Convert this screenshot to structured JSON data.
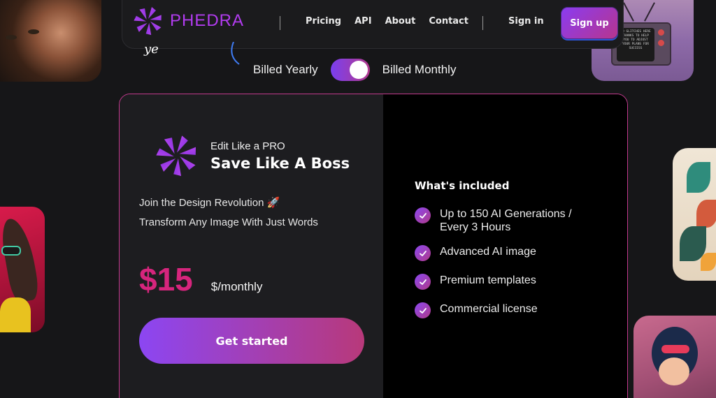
{
  "colors": {
    "accent_purple": "#8a3cf2",
    "accent_pink": "#d6257d",
    "card_border": "#c2398d",
    "brand_text": "#b23cf0"
  },
  "navbar": {
    "brand": "PHEDRA",
    "links": [
      "Pricing",
      "API",
      "About",
      "Contact"
    ],
    "signin": "Sign in",
    "signup": "Sign up"
  },
  "decor": {
    "script_fragment": "ye",
    "tv_screen_text": "NO GLITCHES HERE THANKS TO HELP YOU TO ADJUST YOUR PLANS FOR SUCCESS"
  },
  "billing": {
    "yearly_label": "Billed Yearly",
    "monthly_label": "Billed Monthly",
    "selected": "monthly"
  },
  "plan": {
    "kicker": "Edit Like a PRO",
    "title": "Save Like A Boss",
    "description_line1": "Join the Design Revolution 🚀",
    "description_line2": "Transform Any Image With Just Words",
    "price": "$15",
    "price_unit": "$/monthly",
    "cta": "Get started"
  },
  "included": {
    "title": "What's included",
    "items": [
      "Up to 150 AI Generations / Every 3 Hours",
      "Advanced AI image",
      "Premium templates",
      "Commercial license"
    ]
  },
  "icons": {
    "brand_logo": "pinwheel-logo-icon",
    "check": "check-icon"
  }
}
